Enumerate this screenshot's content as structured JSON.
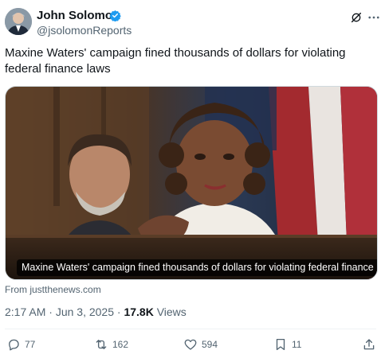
{
  "author": {
    "name": "John Solomon",
    "handle": "@jsolomonReports",
    "verified_color": "#1d9bf0"
  },
  "header_icons": [
    "grok-icon",
    "more-icon"
  ],
  "tweet": {
    "text": "Maxine Waters' campaign fined thousands of dollars for violating federal finance laws"
  },
  "media": {
    "caption": "Maxine Waters' campaign fined thousands of dollars for violating federal finance laws"
  },
  "link_source": "From justthenews.com",
  "meta": {
    "time": "2:17 AM",
    "separator": "·",
    "date": "Jun 3, 2025",
    "views_count": "17.8K",
    "views_label": "Views"
  },
  "actions": {
    "replies": "77",
    "reposts": "162",
    "likes": "594",
    "bookmarks": "11"
  },
  "colors": {
    "text": "#0f1419",
    "secondary": "#536471",
    "accent": "#1d9bf0"
  }
}
